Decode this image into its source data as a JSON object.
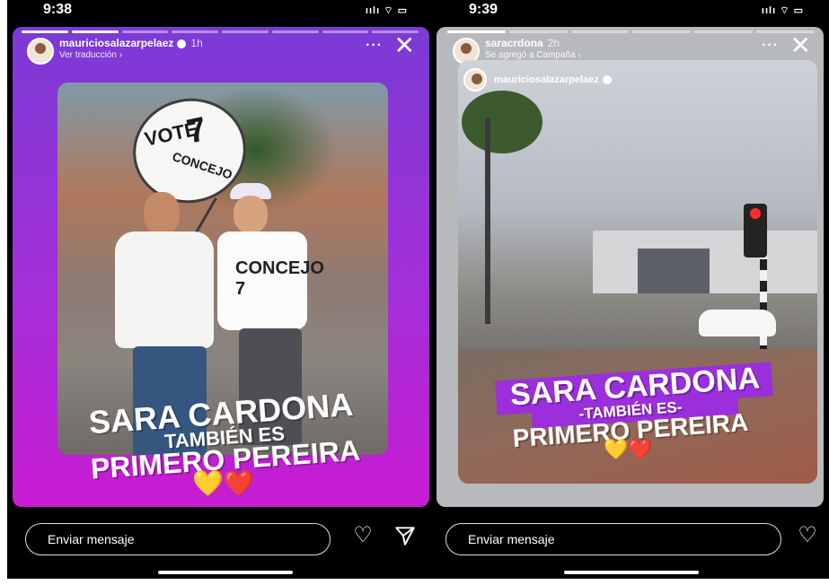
{
  "left_story": {
    "status_time": "9:38",
    "status_icons": "ıılı ⌔ ▭",
    "username": "mauriciosalazarpelaez",
    "time_ago": "1h",
    "subline": "Ver traducción ›",
    "more_label": "···",
    "close_label": "✕",
    "sign": {
      "vote": "VOTE",
      "number": "7",
      "concejo": "CONCEJO"
    },
    "shirt_text": "CONCEJO 7",
    "caption_name": "SARA CARDONA",
    "caption_tambien": "TAMBIÉN ES",
    "caption_primero": "PRIMERO PEREIRA",
    "hearts": "💛❤️",
    "reply_placeholder": "Enviar mensaje",
    "progress_segments": 8,
    "progress_done": 2
  },
  "right_story": {
    "status_time": "9:39",
    "status_icons": "ıılı ⌔ ▭",
    "username": "saracrdona",
    "time_ago": "2h",
    "subline": "Se agregó a Campaña ›",
    "more_label": "···",
    "close_label": "✕",
    "shared_author": "mauriciosalazarpelaez",
    "caption_name": "SARA CARDONA",
    "caption_tambien": "-TAMBIÉN ES-",
    "caption_primero": "PRIMERO PEREIRA",
    "hearts": "💛❤️",
    "reply_placeholder": "Enviar mensaje"
  },
  "colors": {
    "left_story_top": "#7b3ad6",
    "left_story_bottom": "#c81bd2",
    "right_story_bg": "#b8b9bd",
    "caption_highlight": "#9b2fdb"
  }
}
